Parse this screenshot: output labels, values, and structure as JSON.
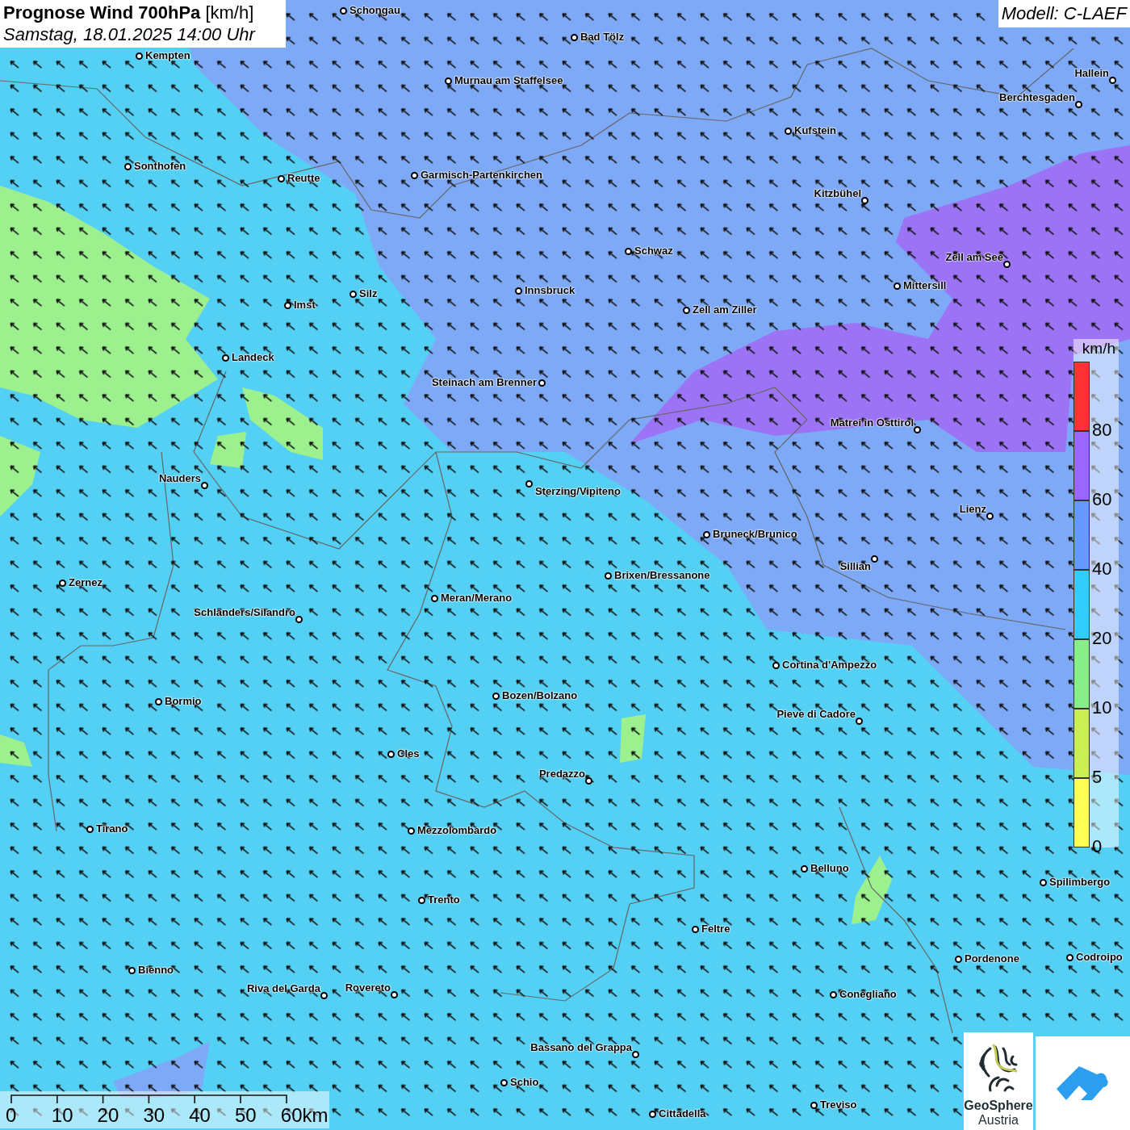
{
  "title_box": {
    "title": "**Prognose Wind 700hPa** [km/h]",
    "subtitle": "Samstag, 18.01.2025 14:00 Uhr"
  },
  "model_box": {
    "text": "Modell: C-LAEF"
  },
  "cities": [
    {
      "name": "Schongau"
    },
    {
      "name": "Kempten"
    },
    {
      "name": "Bad Tölz"
    },
    {
      "name": "Murnau am Staffelsee"
    },
    {
      "name": "Hallein"
    },
    {
      "name": "Berchtesgaden"
    },
    {
      "name": "Kufstein"
    },
    {
      "name": "Sonthofen"
    },
    {
      "name": "Reutte"
    },
    {
      "name": "Garmisch-Partenkirchen"
    },
    {
      "name": "Kitzbühel"
    },
    {
      "name": "Schwaz"
    },
    {
      "name": "Zell am See"
    },
    {
      "name": "Mittersill"
    },
    {
      "name": "Innsbruck"
    },
    {
      "name": "Silz"
    },
    {
      "name": "Imst"
    },
    {
      "name": "Zell am Ziller"
    },
    {
      "name": "Landeck"
    },
    {
      "name": "Steinach am Brenner"
    },
    {
      "name": "Matrei in Osttirol"
    },
    {
      "name": "Nauders"
    },
    {
      "name": "Sterzing/Vipiteno"
    },
    {
      "name": "Lienz"
    },
    {
      "name": "Bruneck/Brunico"
    },
    {
      "name": "Sillian"
    },
    {
      "name": "Zernez"
    },
    {
      "name": "Brixen/Bressanone"
    },
    {
      "name": "Meran/Merano"
    },
    {
      "name": "Schlanders/Silandro"
    },
    {
      "name": "Cortina d'Ampezzo"
    },
    {
      "name": "Bozen/Bolzano"
    },
    {
      "name": "Bormio"
    },
    {
      "name": "Pieve di Cadore"
    },
    {
      "name": "Cles"
    },
    {
      "name": "Predazzo"
    },
    {
      "name": "Tirano"
    },
    {
      "name": "Mezzolombardo"
    },
    {
      "name": "Belluno"
    },
    {
      "name": "Spilimbergo"
    },
    {
      "name": "Trento"
    },
    {
      "name": "Feltre"
    },
    {
      "name": "Pordenone"
    },
    {
      "name": "Codroipo"
    },
    {
      "name": "Bienno"
    },
    {
      "name": "Riva del Garda"
    },
    {
      "name": "Rovereto"
    },
    {
      "name": "Conegliano"
    },
    {
      "name": "Bassano del Grappa"
    },
    {
      "name": "Schio"
    },
    {
      "name": "Treviso"
    },
    {
      "name": "Cittadella"
    }
  ],
  "legend": {
    "unit": "km/h",
    "bins": [
      {
        "color": "#ff3333",
        "label": "80"
      },
      {
        "color": "#9966ff",
        "label": "60"
      },
      {
        "color": "#6699ff",
        "label": "40"
      },
      {
        "color": "#33ccff",
        "label": "20"
      },
      {
        "color": "#88ee88",
        "label": "10"
      },
      {
        "color": "#ccee55",
        "label": "5"
      },
      {
        "color": "#ffff55",
        "label": "0"
      }
    ]
  },
  "scale_bar": {
    "labels": [
      "0",
      "10",
      "20",
      "30",
      "40",
      "50",
      "60km"
    ]
  },
  "logos": {
    "geosphere": {
      "line_1": "GeoSphere",
      "line_2": "Austria"
    }
  }
}
